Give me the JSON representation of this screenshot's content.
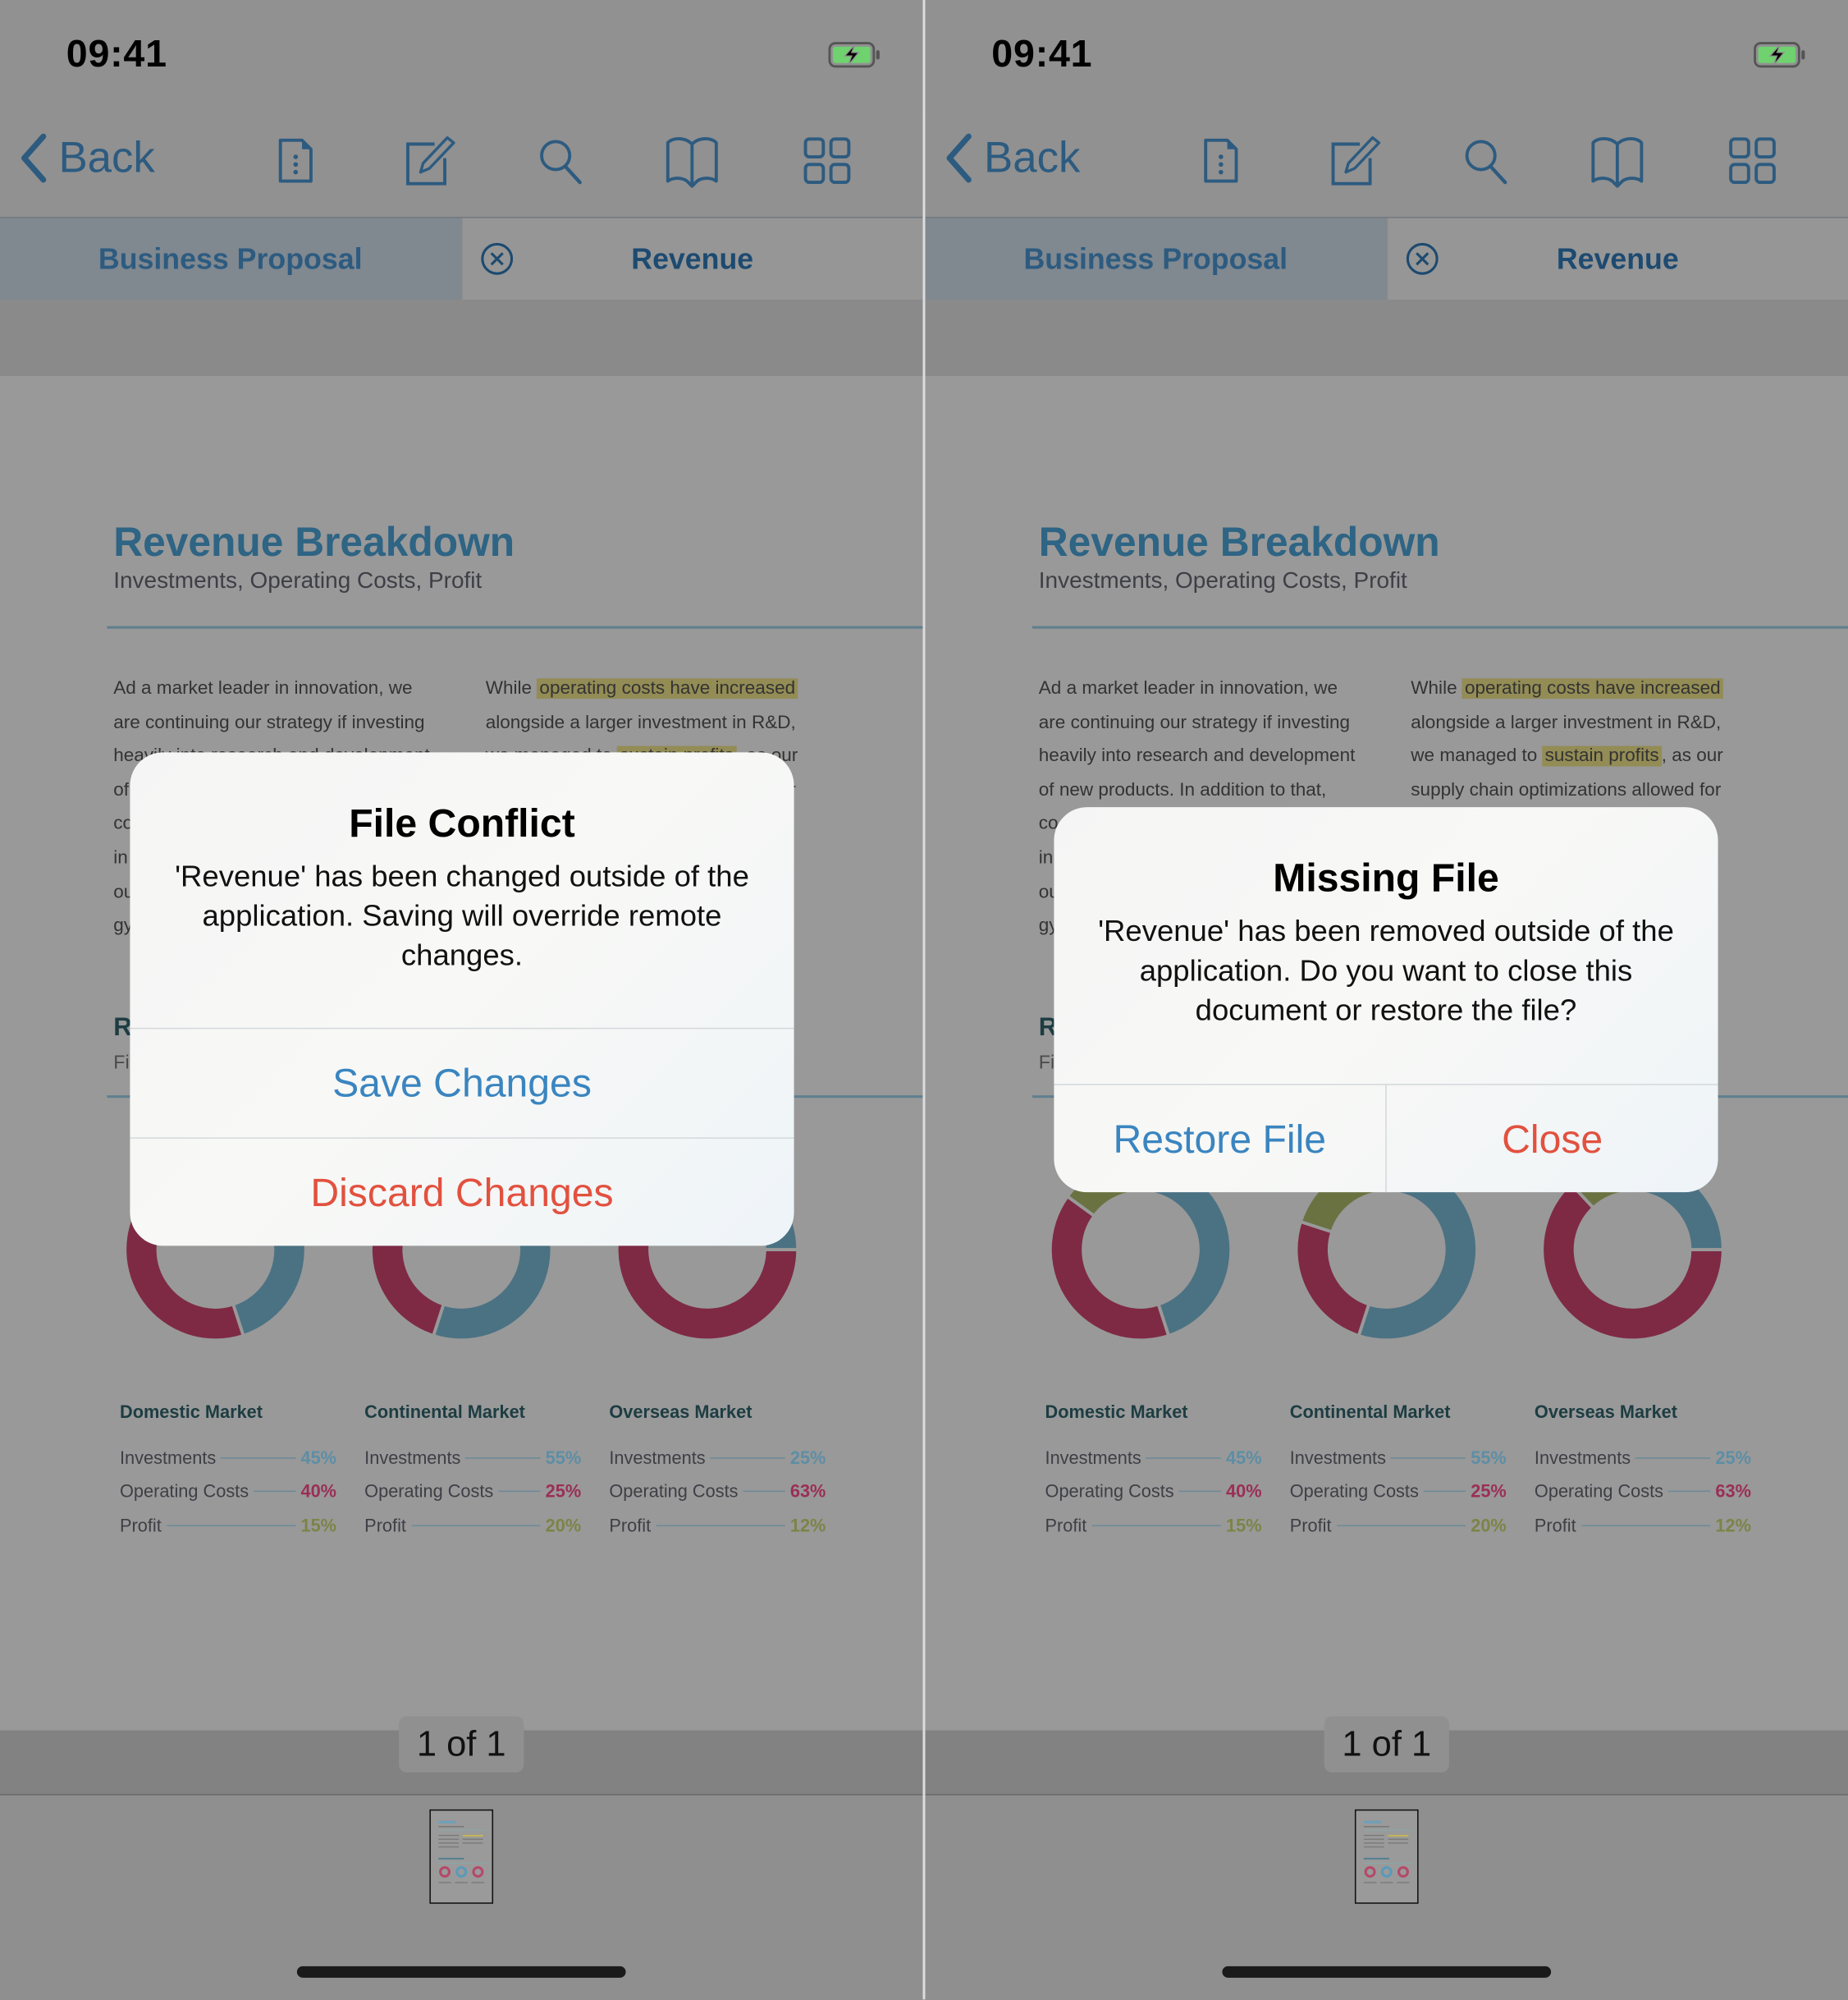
{
  "screens": [
    {
      "status": {
        "time": "09:41",
        "battery_icon": "battery-charging-icon"
      },
      "toolbar": {
        "back_label": "Back",
        "icons": [
          "document-info-icon",
          "edit-icon",
          "search-icon",
          "bookmarks-book-icon",
          "grid-view-icon"
        ]
      },
      "tabs": [
        {
          "label": "Business Proposal",
          "active": false
        },
        {
          "label": "Revenue",
          "active": true,
          "close_icon": "close-circle-icon"
        }
      ],
      "page_indicator": "1 of 1",
      "alert": {
        "title": "File Conflict",
        "message": "'Revenue' has been changed outside of the application. Saving will override remote changes.",
        "buttons": [
          {
            "label": "Save Changes",
            "style": "default"
          },
          {
            "label": "Discard Changes",
            "style": "destructive"
          }
        ],
        "layout": "stacked"
      }
    },
    {
      "status": {
        "time": "09:41",
        "battery_icon": "battery-charging-icon"
      },
      "toolbar": {
        "back_label": "Back",
        "icons": [
          "document-info-icon",
          "edit-icon",
          "search-icon",
          "bookmarks-book-icon",
          "grid-view-icon"
        ]
      },
      "tabs": [
        {
          "label": "Business Proposal",
          "active": false
        },
        {
          "label": "Revenue",
          "active": true,
          "close_icon": "close-circle-icon"
        }
      ],
      "page_indicator": "1 of 1",
      "alert": {
        "title": "Missing File",
        "message": "'Revenue' has been removed outside of the application. Do you want to close this document or restore the file?",
        "buttons": [
          {
            "label": "Restore File",
            "style": "default"
          },
          {
            "label": "Close",
            "style": "destructive"
          }
        ],
        "layout": "side-by-side"
      }
    }
  ],
  "document": {
    "title": "Revenue Breakdown",
    "subtitle": "Investments, Operating Costs, Profit",
    "col1_lines": [
      "Ad a market leader in innovation, we",
      "are continuing our strategy if investing",
      "heavily into research and development",
      "of new products. In addition to that,",
      "co",
      "in",
      "ou",
      "gy"
    ],
    "col2": {
      "line1_pre": "While ",
      "line1_hl": "operating costs have increased",
      "line2": "alongside a larger investment in R&D,",
      "line3_pre": "we managed to ",
      "line3_hl": "sustain profits",
      "line3_post": ", as our",
      "line4": "supply chain optimizations allowed for"
    },
    "section2_title_partial": "R",
    "section2_sub_partial": "Fi",
    "colors": {
      "investments": "#4b7283",
      "operating_costs": "#7e2a45",
      "profit": "#6a7242"
    },
    "markets": [
      {
        "name": "Domestic Market",
        "rows": [
          {
            "label": "Investments",
            "value": "45%"
          },
          {
            "label": "Operating Costs",
            "value": "40%"
          },
          {
            "label": "Profit",
            "value": "15%"
          }
        ]
      },
      {
        "name": "Continental Market",
        "rows": [
          {
            "label": "Investments",
            "value": "55%"
          },
          {
            "label": "Operating Costs",
            "value": "25%"
          },
          {
            "label": "Profit",
            "value": "20%"
          }
        ]
      },
      {
        "name": "Overseas Market",
        "rows": [
          {
            "label": "Investments",
            "value": "25%"
          },
          {
            "label": "Operating Costs",
            "value": "63%"
          },
          {
            "label": "Profit",
            "value": "12%"
          }
        ]
      }
    ]
  },
  "chart_data": {
    "type": "pie",
    "variant": "donut",
    "categories": [
      "Investments",
      "Operating Costs",
      "Profit"
    ],
    "series": [
      {
        "name": "Domestic Market",
        "values": [
          45,
          40,
          15
        ]
      },
      {
        "name": "Continental Market",
        "values": [
          55,
          25,
          20
        ]
      },
      {
        "name": "Overseas Market",
        "values": [
          25,
          63,
          12
        ]
      }
    ],
    "colors": [
      "#4b7283",
      "#7e2a45",
      "#6a7242"
    ]
  }
}
